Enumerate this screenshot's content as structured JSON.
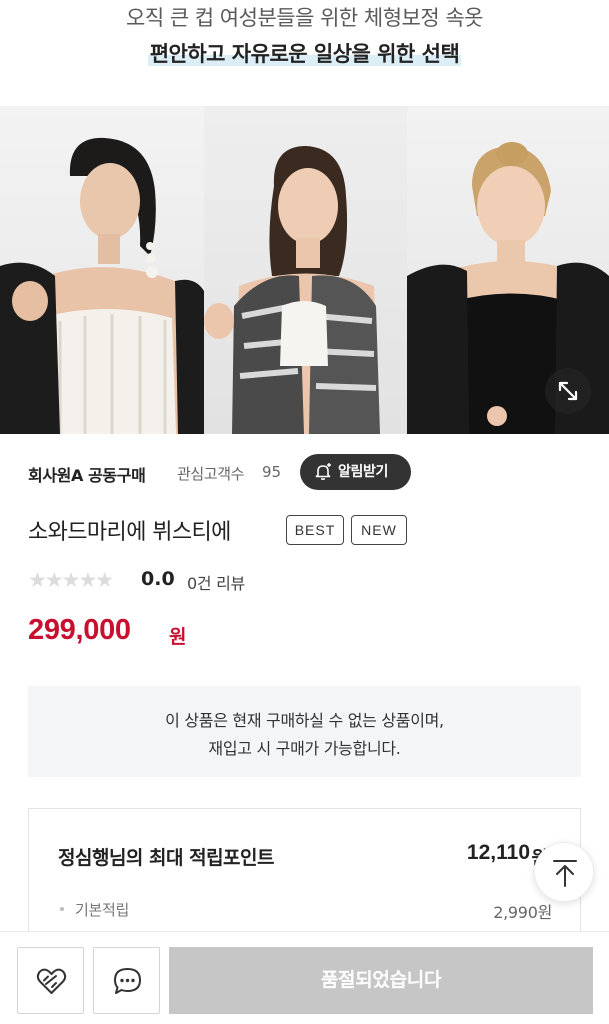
{
  "promo": {
    "line1": "오직 큰 컵 여성분들을 위한 체형보정 속옷",
    "line2": "편안하고 자유로운 일상을 위한 선택"
  },
  "brand": {
    "name": "회사원A 공동구매",
    "watch_label": "관심고객수",
    "watch_count": "95",
    "alarm_label": "알림받기"
  },
  "product": {
    "title": "소와드마리에 뷔스티에",
    "badges": [
      "BEST",
      "NEW"
    ],
    "rating_score": "0.0",
    "rating_value": 0,
    "rating_max": 5,
    "review_count": "0건 리뷰",
    "price": "299,000",
    "currency": "원"
  },
  "notice": {
    "line1": "이 상품은 현재 구매하실 수 없는 상품이며,",
    "line2": "재입고 시 구매가 가능합니다."
  },
  "points": {
    "label": "정심행님의 최대 적립포인트",
    "value": "12,110",
    "unit": "원",
    "basic_label": "기본적립",
    "basic_value": "2,990원"
  },
  "actions": {
    "wish_icon": "heart-link-icon",
    "chat_icon": "chat-bubble-icon",
    "soldout_label": "품절되었습니다",
    "top_icon": "arrow-up-to-top-icon",
    "expand_icon": "expand-arrows-icon"
  },
  "colors": {
    "price": "#c8102e",
    "alarm_bg": "#333333",
    "soldout_bg": "#c6c6c6",
    "notice_bg": "#f4f5f7",
    "highlight": "#dbeef6"
  }
}
